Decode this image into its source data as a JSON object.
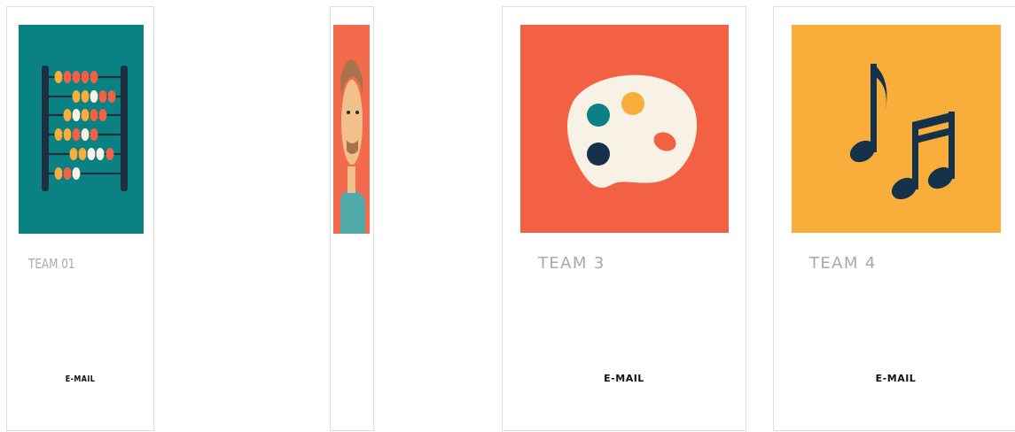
{
  "colors": {
    "teal": "#0a8283",
    "coral": "#f26144",
    "orange_red": "#f36b4c",
    "amber": "#f9ae3b",
    "navy": "#16324a",
    "cream": "#f7f1e6",
    "card_border": "#dedede",
    "name_text": "#a9a9a9"
  },
  "cards": [
    {
      "name": "TEAM 01",
      "email_label": "E-MAIL",
      "icon": "abacus-icon"
    },
    {
      "name": "",
      "email_label": "",
      "icon": "person-icon"
    },
    {
      "name": "TEAM 3",
      "email_label": "E-MAIL",
      "icon": "palette-icon"
    },
    {
      "name": "TEAM 4",
      "email_label": "E-MAIL",
      "icon": "music-notes-icon"
    }
  ]
}
